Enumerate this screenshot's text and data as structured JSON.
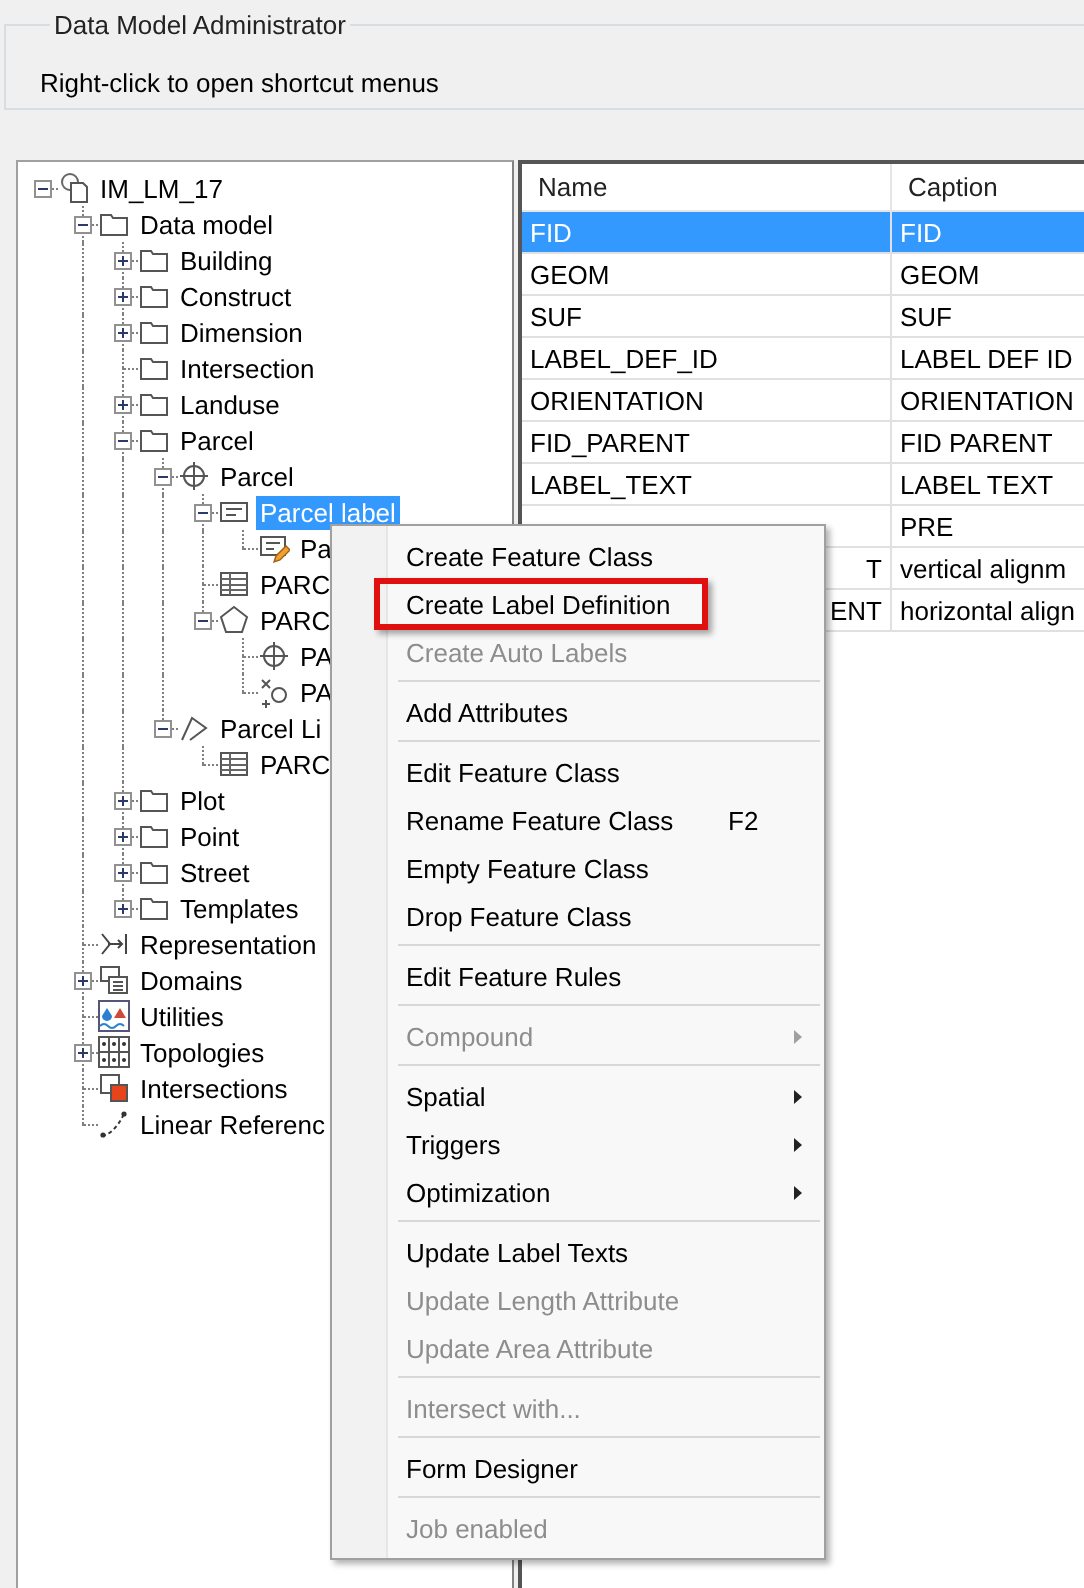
{
  "group": {
    "title": "Data Model Administrator",
    "hint": "Right-click to open shortcut menus"
  },
  "tree": [
    {
      "label": "IM_LM_17",
      "kind": "database",
      "expanded": true,
      "selected": false,
      "children": [
        {
          "label": "Data model",
          "kind": "folder",
          "expanded": true,
          "selected": false,
          "children": [
            {
              "label": "Building",
              "kind": "folder",
              "expanded": false,
              "selected": false
            },
            {
              "label": "Construct",
              "kind": "folder",
              "expanded": false,
              "selected": false
            },
            {
              "label": "Dimension",
              "kind": "folder",
              "expanded": false,
              "selected": false
            },
            {
              "label": "Intersection",
              "kind": "folder",
              "selected": false
            },
            {
              "label": "Landuse",
              "kind": "folder",
              "expanded": false,
              "selected": false
            },
            {
              "label": "Parcel",
              "kind": "folder",
              "expanded": true,
              "selected": false,
              "children": [
                {
                  "label": "Parcel",
                  "kind": "pointclass",
                  "expanded": true,
                  "selected": false,
                  "children": [
                    {
                      "label": "Parcel label",
                      "kind": "label",
                      "expanded": true,
                      "selected": true,
                      "children": [
                        {
                          "label": "Pa",
                          "kind": "labeldef",
                          "selected": false
                        }
                      ]
                    },
                    {
                      "label": "PARC",
                      "kind": "table",
                      "selected": false
                    },
                    {
                      "label": "PARC",
                      "kind": "polygon",
                      "expanded": true,
                      "selected": false,
                      "children": [
                        {
                          "label": "PA",
                          "kind": "point",
                          "selected": false
                        },
                        {
                          "label": "PA",
                          "kind": "symbol",
                          "selected": false
                        }
                      ]
                    }
                  ]
                },
                {
                  "label": "Parcel Li",
                  "kind": "line",
                  "expanded": true,
                  "selected": false,
                  "children": [
                    {
                      "label": "PARC",
                      "kind": "table",
                      "selected": false
                    }
                  ]
                }
              ]
            },
            {
              "label": "Plot",
              "kind": "folder",
              "expanded": false,
              "selected": false
            },
            {
              "label": "Point",
              "kind": "folder",
              "expanded": false,
              "selected": false
            },
            {
              "label": "Street",
              "kind": "folder",
              "expanded": false,
              "selected": false
            },
            {
              "label": "Templates",
              "kind": "folder",
              "expanded": false,
              "selected": false
            }
          ]
        },
        {
          "label": "Representation",
          "kind": "representation",
          "selected": false
        },
        {
          "label": "Domains",
          "kind": "domains",
          "expanded": false,
          "selected": false
        },
        {
          "label": "Utilities",
          "kind": "utilities",
          "selected": false
        },
        {
          "label": "Topologies",
          "kind": "topologies",
          "expanded": false,
          "selected": false
        },
        {
          "label": "Intersections",
          "kind": "intersections",
          "selected": false
        },
        {
          "label": "Linear Referenc",
          "kind": "linear",
          "selected": false
        }
      ]
    }
  ],
  "table": {
    "columns": [
      "Name",
      "Caption"
    ],
    "rows": [
      {
        "name": "FID",
        "caption": "FID",
        "selected": true,
        "covered": false
      },
      {
        "name": "GEOM",
        "caption": "GEOM",
        "selected": false,
        "covered": false
      },
      {
        "name": "SUF",
        "caption": "SUF",
        "selected": false,
        "covered": false
      },
      {
        "name": "LABEL_DEF_ID",
        "caption": "LABEL DEF ID",
        "selected": false,
        "covered": false
      },
      {
        "name": "ORIENTATION",
        "caption": "ORIENTATION",
        "selected": false,
        "covered": false
      },
      {
        "name": "FID_PARENT",
        "caption": "FID PARENT",
        "selected": false,
        "covered": false
      },
      {
        "name": "LABEL_TEXT",
        "caption": "LABEL TEXT",
        "selected": false,
        "covered": false
      },
      {
        "caption": "PRE",
        "selected": false
      },
      {
        "name": "T",
        "caption": "vertical alignm",
        "selected": false,
        "covered": true
      },
      {
        "name": "ENT",
        "caption": "horizontal align",
        "selected": false,
        "covered": true
      }
    ]
  },
  "context_menu": [
    {
      "kind": "item",
      "label": "Create Feature Class",
      "disabled": false,
      "highlighted": false
    },
    {
      "kind": "item",
      "label": "Create Label Definition",
      "disabled": false,
      "highlighted": true
    },
    {
      "kind": "item",
      "label": "Create Auto Labels",
      "disabled": true,
      "highlighted": false
    },
    {
      "kind": "separator"
    },
    {
      "kind": "item",
      "label": "Add Attributes",
      "disabled": false,
      "highlighted": false
    },
    {
      "kind": "separator"
    },
    {
      "kind": "item",
      "label": "Edit Feature Class",
      "disabled": false,
      "highlighted": false
    },
    {
      "kind": "item",
      "label": "Rename Feature Class",
      "shortcut": "F2",
      "disabled": false,
      "highlighted": false
    },
    {
      "kind": "item",
      "label": "Empty Feature Class",
      "disabled": false,
      "highlighted": false
    },
    {
      "kind": "item",
      "label": "Drop Feature Class",
      "disabled": false,
      "highlighted": false
    },
    {
      "kind": "separator"
    },
    {
      "kind": "item",
      "label": "Edit Feature Rules",
      "disabled": false,
      "highlighted": false
    },
    {
      "kind": "separator"
    },
    {
      "kind": "item",
      "label": "Compound",
      "submenu": true,
      "disabled": true,
      "highlighted": false
    },
    {
      "kind": "separator"
    },
    {
      "kind": "item",
      "label": "Spatial",
      "submenu": true,
      "disabled": false,
      "highlighted": false
    },
    {
      "kind": "item",
      "label": "Triggers",
      "submenu": true,
      "disabled": false,
      "highlighted": false
    },
    {
      "kind": "item",
      "label": "Optimization",
      "submenu": true,
      "disabled": false,
      "highlighted": false
    },
    {
      "kind": "separator"
    },
    {
      "kind": "item",
      "label": "Update Label Texts",
      "disabled": false,
      "highlighted": false
    },
    {
      "kind": "item",
      "label": "Update Length Attribute",
      "disabled": true,
      "highlighted": false
    },
    {
      "kind": "item",
      "label": "Update Area Attribute",
      "disabled": true,
      "highlighted": false
    },
    {
      "kind": "separator"
    },
    {
      "kind": "item",
      "label": "Intersect with...",
      "disabled": true,
      "highlighted": false
    },
    {
      "kind": "separator"
    },
    {
      "kind": "item",
      "label": "Form Designer",
      "disabled": false,
      "highlighted": false
    },
    {
      "kind": "separator"
    },
    {
      "kind": "item",
      "label": "Job enabled",
      "disabled": true,
      "highlighted": false
    }
  ]
}
